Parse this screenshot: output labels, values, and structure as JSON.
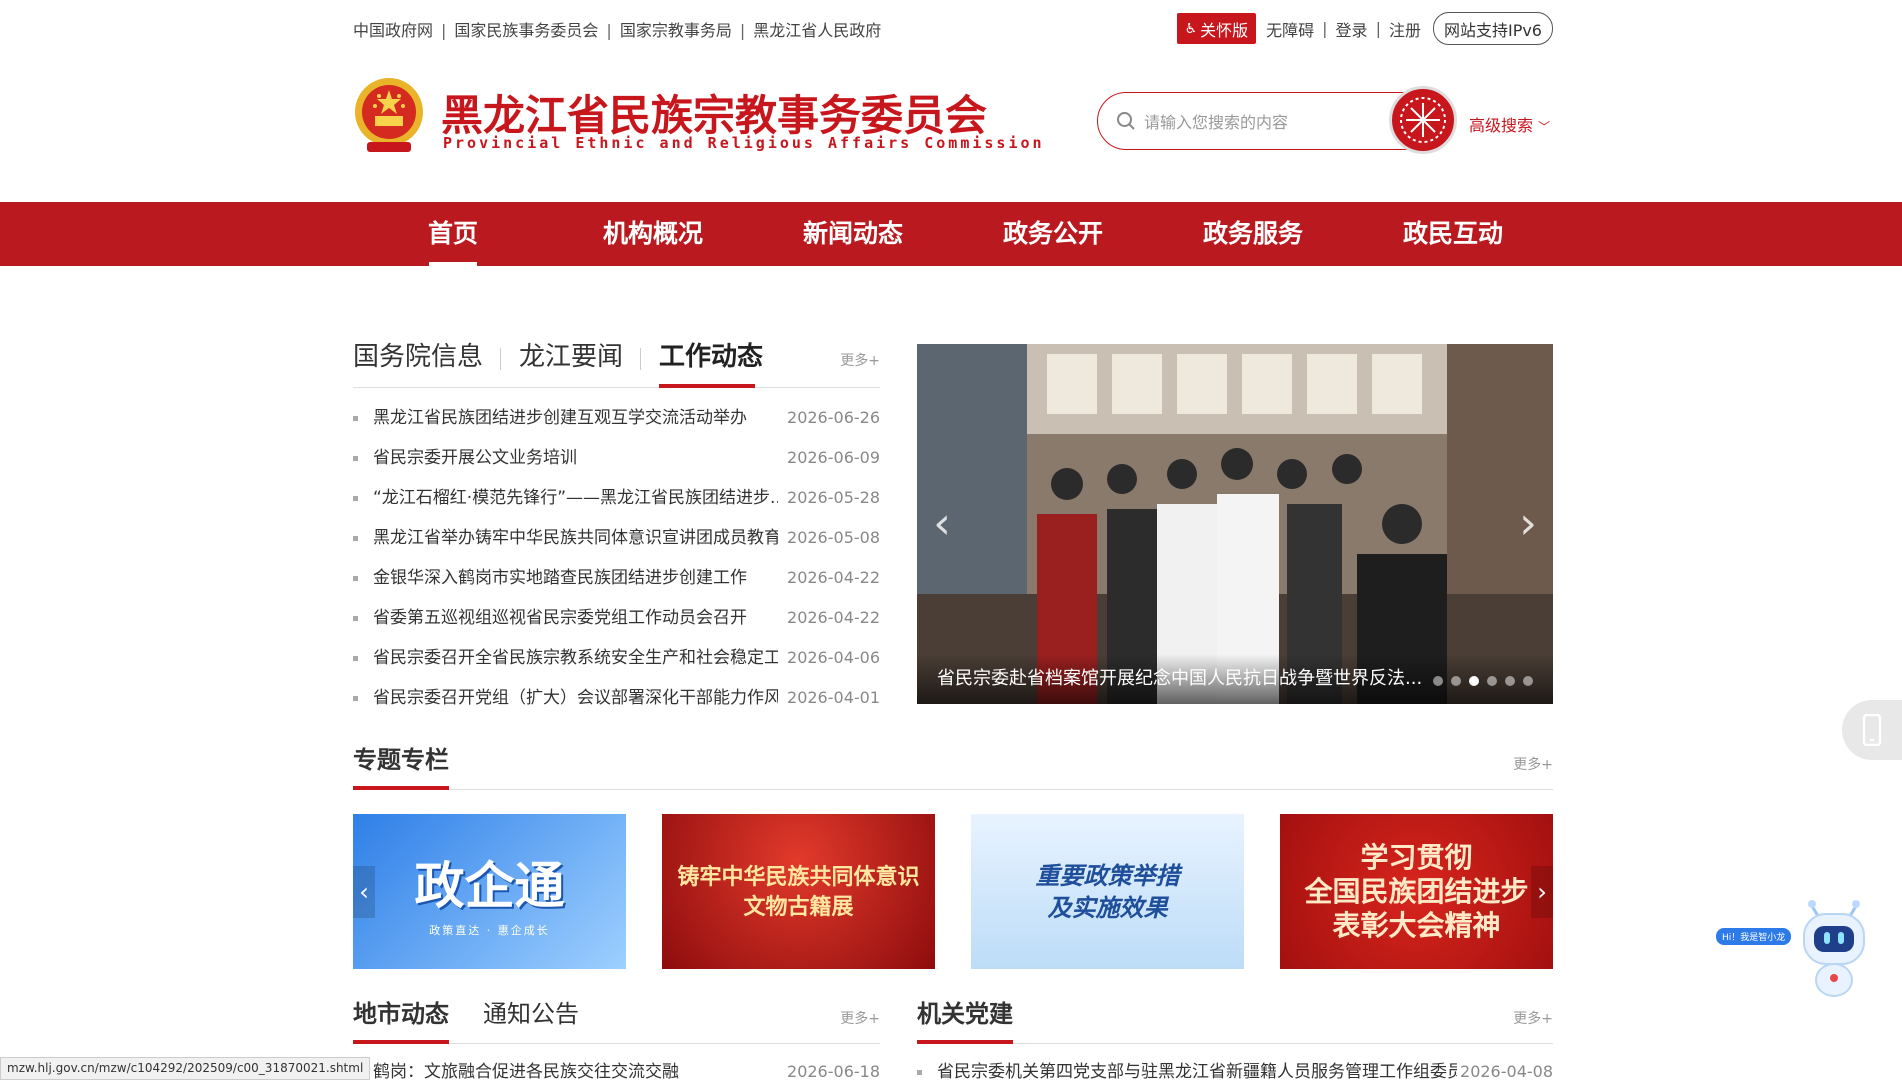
{
  "toplinks": [
    "中国政府网",
    "国家民族事务委员会",
    "国家宗教事务局",
    "黑龙江省人民政府"
  ],
  "topright": {
    "care": "关怀版",
    "accessible": "无障碍",
    "login": "登录",
    "register": "注册",
    "ipv6": "网站支持IPv6"
  },
  "header": {
    "title": "黑龙江省民族宗教事务委员会",
    "subtitle": "Provincial Ethnic and Religious Affairs Commission"
  },
  "search": {
    "placeholder": "请输入您搜索的内容",
    "advanced": "高级搜索"
  },
  "nav": [
    "首页",
    "机构概况",
    "新闻动态",
    "政务公开",
    "政务服务",
    "政民互动"
  ],
  "news": {
    "tabs": [
      "国务院信息",
      "龙江要闻",
      "工作动态"
    ],
    "active_tab": "工作动态",
    "more": "更多+",
    "items": [
      {
        "title": "黑龙江省民族团结进步创建互观互学交流活动举办",
        "date": "2026-06-26"
      },
      {
        "title": "省民宗委开展公文业务培训",
        "date": "2026-06-09"
      },
      {
        "title": "“龙江石榴红·模范先锋行”——黑龙江省民族团结进步...",
        "date": "2026-05-28"
      },
      {
        "title": "黑龙江省举办铸牢中华民族共同体意识宣讲团成员教育...",
        "date": "2026-05-08"
      },
      {
        "title": "金银华深入鹤岗市实地踏查民族团结进步创建工作",
        "date": "2026-04-22"
      },
      {
        "title": "省委第五巡视组巡视省民宗委党组工作动员会召开",
        "date": "2026-04-22"
      },
      {
        "title": "省民宗委召开全省民族宗教系统安全生产和社会稳定工...",
        "date": "2026-04-06"
      },
      {
        "title": "省民宗委召开党组（扩大）会议部署深化干部能力作风...",
        "date": "2026-04-01"
      }
    ]
  },
  "carousel": {
    "caption": "省民宗委赴省档案馆开展纪念中国人民抗日战争暨世界反法...",
    "slides": 6,
    "active": 3
  },
  "topics": {
    "title": "专题专栏",
    "more": "更多+",
    "cards": [
      {
        "line1": "政企通",
        "line2": "政策直达 · 惠企成长"
      },
      {
        "line1": "铸牢中华民族共同体意识",
        "line2": "文物古籍展"
      },
      {
        "line1": "重要政策举措",
        "line2": "及实施效果"
      },
      {
        "line1": "学习贯彻",
        "line2": "全国民族团结进步",
        "line3": "表彰大会精神"
      }
    ]
  },
  "local": {
    "tabs": [
      "地市动态",
      "通知公告"
    ],
    "more": "更多+",
    "items": [
      {
        "title": "鹤岗：文旅融合促进各民族交往交流交融",
        "date": "2026-06-18"
      }
    ]
  },
  "party": {
    "title": "机关党建",
    "more": "更多+",
    "items": [
      {
        "title": "省民宗委机关第四党支部与驻黑龙江省新疆籍人员服务管理工作组委员...",
        "date": "2026-04-08"
      }
    ]
  },
  "status_url": "mzw.hlj.gov.cn/mzw/c104292/202509/c00_31870021.shtml",
  "robot_bubble": "Hi！我是智小龙"
}
